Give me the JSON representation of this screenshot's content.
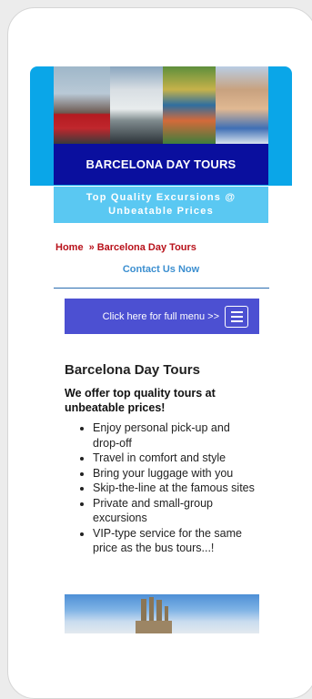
{
  "header": {
    "title": "BARCELONA DAY TOURS",
    "tagline_line1": "Top Quality Excursions @",
    "tagline_line2": "Unbeatable Prices"
  },
  "breadcrumb": {
    "home": "Home",
    "separator": "»",
    "current": "Barcelona Day Tours"
  },
  "contact_link": "Contact Us Now",
  "menu": {
    "label": "Click here for full menu >>",
    "icon": "hamburger-menu-icon"
  },
  "main": {
    "heading": "Barcelona Day Tours",
    "subheading": "We offer top quality tours at unbeatable prices!",
    "features": [
      "Enjoy personal pick-up and drop-off",
      "Travel in comfort and style",
      "Bring your luggage with you",
      "Skip-the-line at the famous sites",
      "Private and small-group excursions",
      "VIP-type service for the same price as the bus tours...!"
    ]
  },
  "colors": {
    "header_blue": "#0aa6e8",
    "title_navy": "#0a0f9e",
    "tagline_cyan": "#5ac8f2",
    "breadcrumb_red": "#b8111a",
    "link_blue": "#3c8fd0",
    "menu_button": "#4c50d2"
  }
}
